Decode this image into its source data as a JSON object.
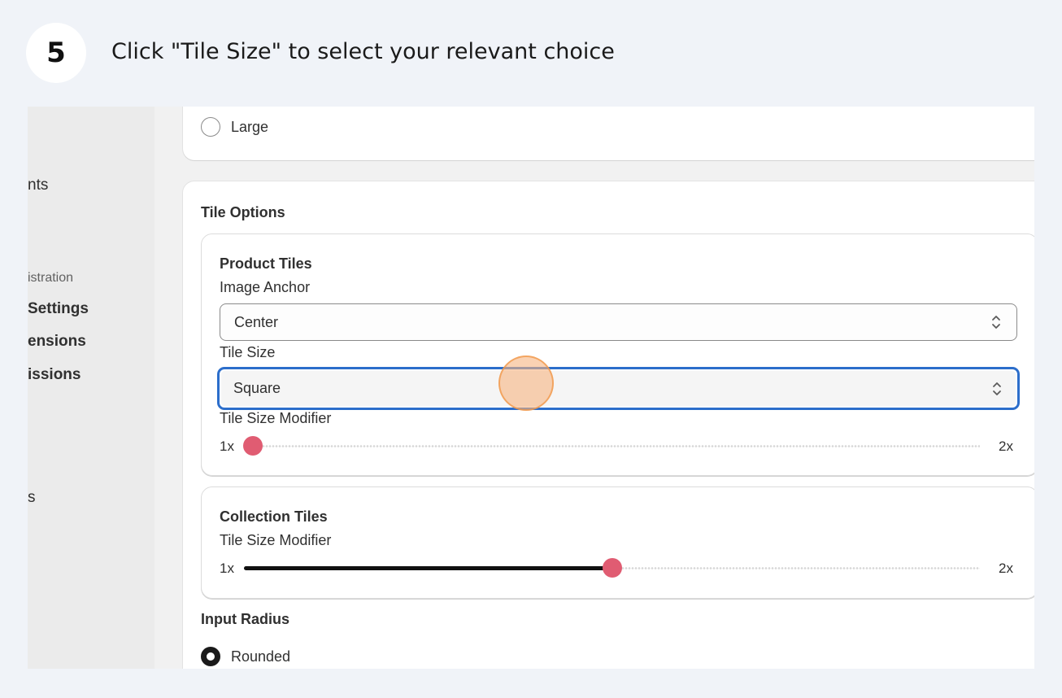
{
  "step": {
    "number": "5",
    "instruction": "Click \"Tile Size\" to select your relevant choice"
  },
  "sidebar": {
    "items": [
      {
        "label": "nts"
      },
      {
        "label": "Settings"
      },
      {
        "label": "ensions"
      },
      {
        "label": "issions"
      },
      {
        "label": "s"
      }
    ],
    "section_label": "istration"
  },
  "size_card": {
    "option_large": "Large"
  },
  "tile_options": {
    "title": "Tile Options",
    "product_tiles": {
      "title": "Product Tiles",
      "image_anchor_label": "Image Anchor",
      "image_anchor_value": "Center",
      "tile_size_label": "Tile Size",
      "tile_size_value": "Square",
      "modifier_label": "Tile Size Modifier",
      "min_label": "1x",
      "max_label": "2x",
      "modifier_value": 0.0
    },
    "collection_tiles": {
      "title": "Collection Tiles",
      "modifier_label": "Tile Size Modifier",
      "min_label": "1x",
      "max_label": "2x",
      "modifier_value": 0.5
    }
  },
  "input_radius": {
    "title": "Input Radius",
    "option_rounded": "Rounded"
  },
  "colors": {
    "focus": "#2c6ecb",
    "slider_thumb": "#e05c72",
    "click_marker": "#f6b480"
  }
}
